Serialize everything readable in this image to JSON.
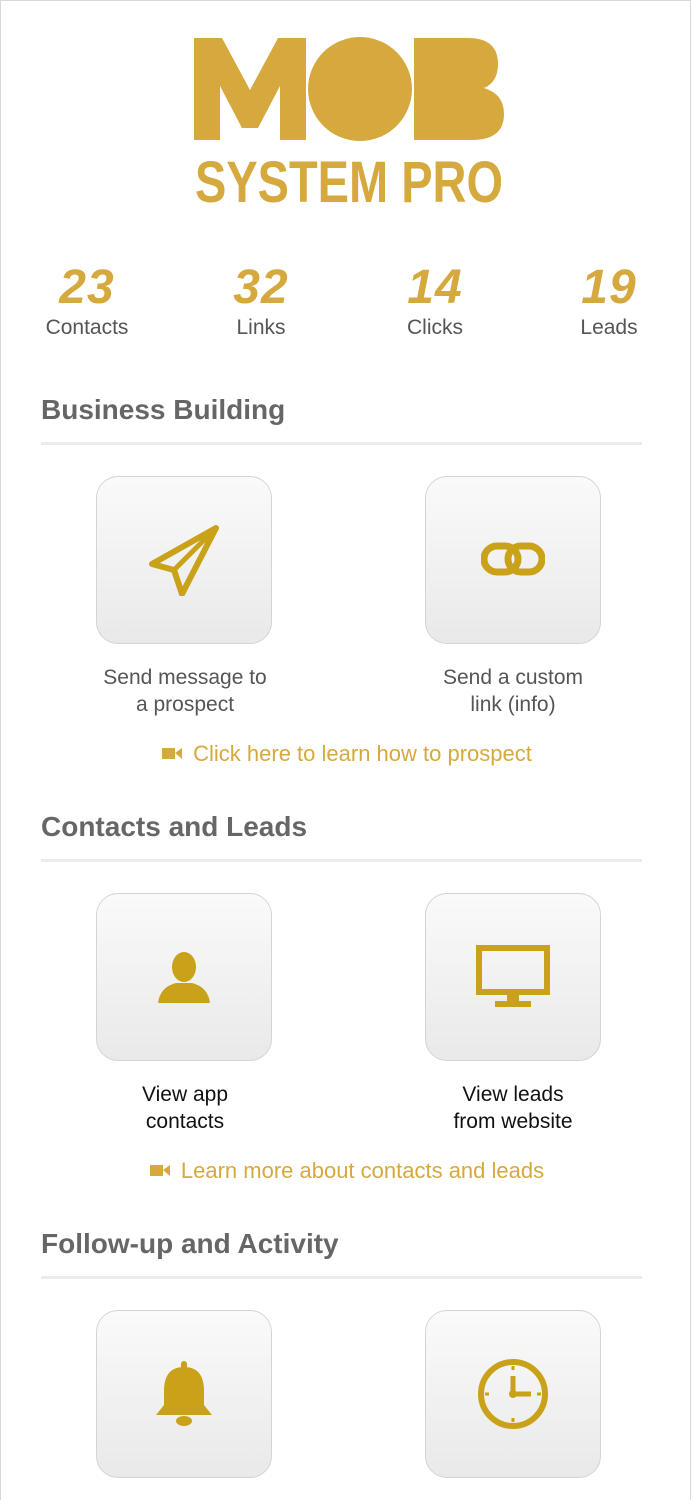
{
  "brand": {
    "logo_text_top": "MOB",
    "logo_text_bottom": "SYSTEM PRO",
    "accent_color": "#d6a93e"
  },
  "stats": [
    {
      "value": "23",
      "label": "Contacts"
    },
    {
      "value": "32",
      "label": "Links"
    },
    {
      "value": "14",
      "label": "Clicks"
    },
    {
      "value": "19",
      "label": "Leads"
    }
  ],
  "sections": [
    {
      "title": "Business Building",
      "tiles": [
        {
          "icon": "paper-plane-icon",
          "caption_line1": "Send message to",
          "caption_line2": "a prospect"
        },
        {
          "icon": "link-icon",
          "caption_line1": "Send a custom",
          "caption_line2": "link (info)"
        }
      ],
      "learn_icon": "video-camera-icon",
      "learn_text": "Click here to learn how to prospect"
    },
    {
      "title": "Contacts and Leads",
      "tiles": [
        {
          "icon": "user-icon",
          "caption_line1": "View app",
          "caption_line2": "contacts"
        },
        {
          "icon": "monitor-icon",
          "caption_line1": "View leads",
          "caption_line2": "from website"
        }
      ],
      "learn_icon": "video-camera-icon",
      "learn_text": "Learn more about contacts and leads"
    },
    {
      "title": "Follow-up and Activity",
      "tiles": [
        {
          "icon": "bell-icon"
        },
        {
          "icon": "clock-icon"
        }
      ]
    }
  ]
}
